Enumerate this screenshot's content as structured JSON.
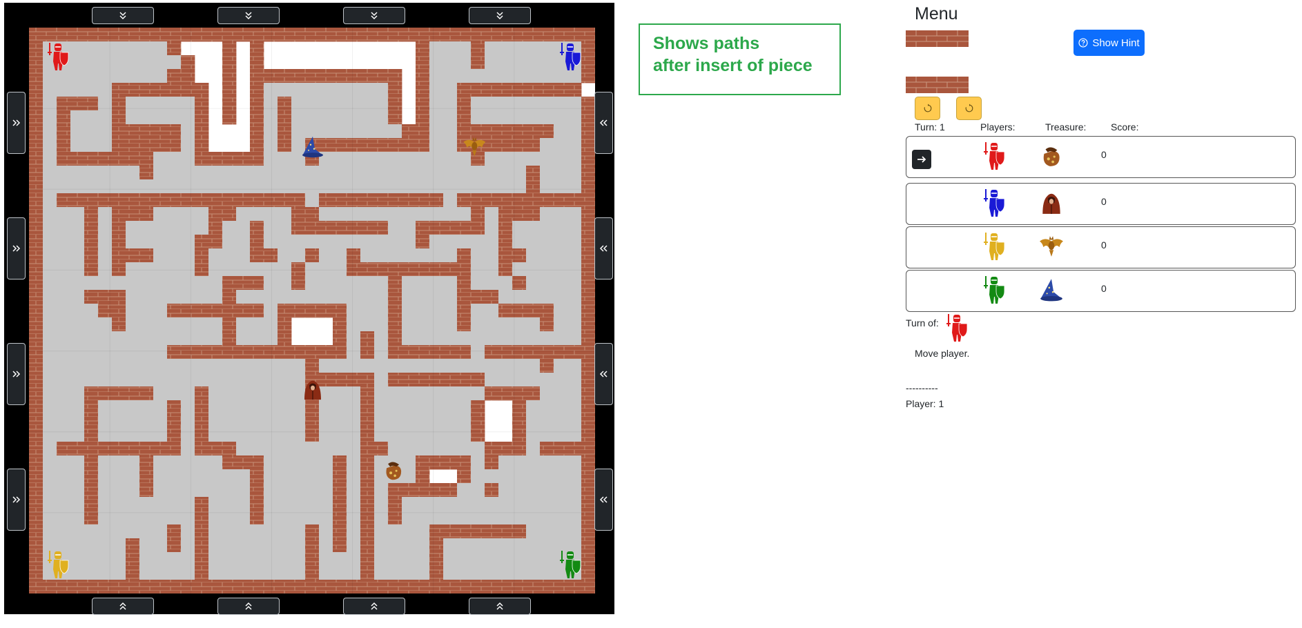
{
  "board": {
    "grid": [
      "#########################################",
      "#.........#...#.#...........#...#.......#",
      "#..........#..#.#...........#...#.......#",
      "#.........##..#.###########.#...........#",
      "#.....#######.#.#.........#.#..#########.",
      "#.###.#.....#.#.#.#.......#.#..#........#",
      "#.#...#.....#.#.#.#.......#.#..#........#",
      "#.#...#####.#...#.#........##..#######..#",
      "#.#...#####.#...#.#.#########..######...#",
      "#.#######...#####...#...........#.......#",
      "#.......#...........................#...#",
      "#...................................#...#",
      "#.##################.#########.##########",
      "#...#.###....##....##...........#.###...#",
      "#...#.#......#..#..#######..#####.#.....#",
      "#...#.#.....##..#...........#.....#.....#",
      "#...#.###...#...##..#..#.......#..##....#",
      "#...#.#.....#......#...#########..#.....#",
      "#.............###..#......#....#...#....#",
      "#...###.......#...........#....###......#",
      "#....##...#######.#####...#....#..####..#",
      "#.....#.......#...#...#...#....#.....#..#",
      "#.............#...#...#.#.#.............#",
      "#.........#############.#.######.########",
      "#...................#................#..#",
      "#...................#####.#######.......#",
      "#...#####...#.......#...#........####...#",
      "#...#.....#.#.......#...#.......#..#....#",
      "#...#.....#.#.......#...#.......#..#....#",
      "#...#.....#.#.......#...#.......#..#....#",
      "#.#########.###.........##.......###.####",
      "#...#...#.....###.....#.#...####.#......#",
      "#...#...#.......#.....#.#...#..#........#",
      "#...#...#.......#.....#.#.#####..#......#",
      "#...#.......#...#.....#.#.#.............#",
      "#...#.......#...#.....#.#.#.............#",
      "#.........#.#.......#.#.#....#######....#",
      "#......#..#.#.......#.#.#....#..........#",
      "#......#....#.......#...#....#..........#",
      "#......#....#.......#...#....#..........#",
      "#########################################"
    ],
    "colors": {
      "wall": "#a9563d",
      "path": "#c8c8c8",
      "open": "#ffffff",
      "frame": "#000000",
      "button": "#212529"
    },
    "tokens": [
      {
        "kind": "knight",
        "color": "#e01a1a",
        "row": 0,
        "col": 0
      },
      {
        "kind": "knight",
        "color": "#1a1ad6",
        "row": 0,
        "col": 6
      },
      {
        "kind": "knight",
        "color": "#e0b020",
        "row": 6,
        "col": 0
      },
      {
        "kind": "knight",
        "color": "#138a13",
        "row": 6,
        "col": 6
      },
      {
        "kind": "wizard-hat",
        "row": 1,
        "col": 3
      },
      {
        "kind": "bat",
        "row": 1,
        "col": 5
      },
      {
        "kind": "monk",
        "row": 4,
        "col": 3
      },
      {
        "kind": "treasure-bag",
        "row": 5,
        "col": 4
      }
    ]
  },
  "shift_buttons": {
    "top": [
      "down",
      "down",
      "down",
      "down"
    ],
    "bottom": [
      "up",
      "up",
      "up",
      "up"
    ],
    "left": [
      "right",
      "right",
      "right",
      "right"
    ],
    "right": [
      "left",
      "left",
      "left",
      "left"
    ]
  },
  "note": {
    "line1": "Shows paths",
    "line2": "after insert of piece",
    "color": "#2ca84b"
  },
  "menu": {
    "title": "Menu",
    "hint_label": "Show Hint",
    "hint_icon": "question-circle-icon",
    "rotate_icon": "rotate-icon"
  },
  "status": {
    "turn_label": "Turn: 1",
    "players_label": "Players:",
    "treasure_label": "Treasure:",
    "score_label": "Score:"
  },
  "players": [
    {
      "color": "#e01a1a",
      "treasure": "treasure-bag",
      "score": "0",
      "active": true
    },
    {
      "color": "#1a1ad6",
      "treasure": "monk",
      "score": "0",
      "active": false
    },
    {
      "color": "#e0b020",
      "treasure": "bat",
      "score": "0",
      "active": false
    },
    {
      "color": "#138a13",
      "treasure": "wizard-hat",
      "score": "0",
      "active": false
    }
  ],
  "turn_of": {
    "label": "Turn of:",
    "color": "#e01a1a"
  },
  "message": "Move player.",
  "divider": "----------",
  "player_line": "Player: 1"
}
